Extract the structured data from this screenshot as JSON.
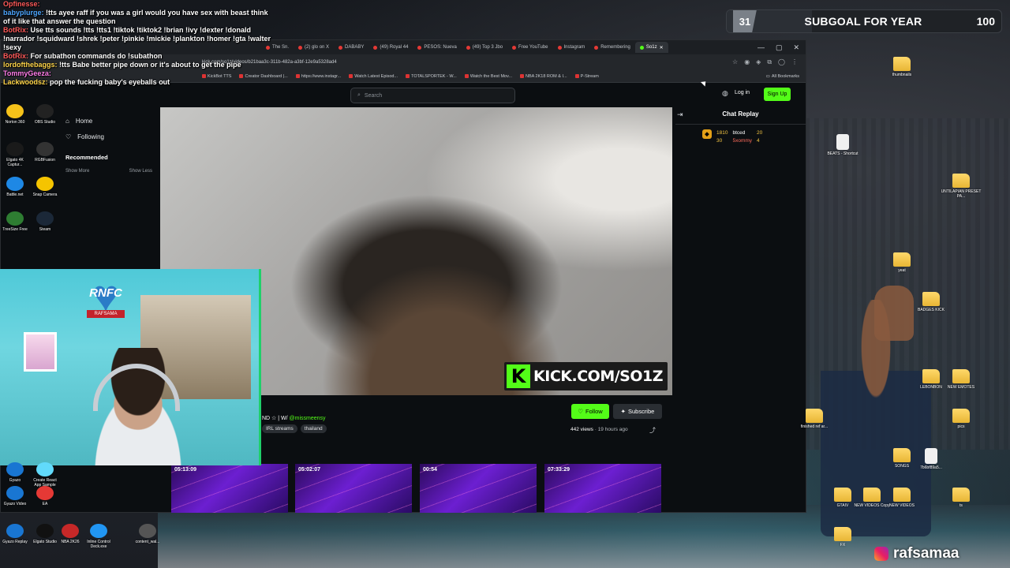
{
  "overlay_chat": [
    {
      "name": "Opfinesse:",
      "text": "",
      "color": "#ff5a5a"
    },
    {
      "name": "babyplurge:",
      "text": " !tts ayee raff if you was a girl would you have sex with beast think of it like that answer the question",
      "color": "#4da6ff"
    },
    {
      "name": "BotRix:",
      "text": " Use tts sounds !tts !tts1 !tiktok !tiktok2 !brian !ivy !dexter !donald !narrador !squidward !shrek !peter !pinkie !mickie !plankton !homer !gta !walter !sexy",
      "color": "#ff5a5a"
    },
    {
      "name": "BotRix:",
      "text": " For subathon commands do !subathon",
      "color": "#ff5a5a"
    },
    {
      "name": "lordofthebaggs:",
      "text": " !tts Babe better pipe down or it's about to get the pipe",
      "color": "#ffd54a"
    },
    {
      "name": "TommyGeeza:",
      "text": "",
      "color": "#ff7de9"
    },
    {
      "name": "Lackwoodsz:",
      "text": " pop the fucking baby's eyeballs out",
      "color": "#ffd54a"
    }
  ],
  "subgoal": {
    "count": "31",
    "title": "SUBGOAL FOR YEAR",
    "target": "100",
    "progress_fraction": 0.31
  },
  "browser": {
    "tabs": [
      "The Sn.",
      "(2) glo on X",
      "DABABY",
      "(49) Royal 44",
      "PESOS: Nueva",
      "(49) Top 3 Jbo",
      "Free YouTube",
      "Instagram",
      "Remembering",
      "So1z"
    ],
    "url": "kick.com/so1z/videos/b21baa3c-311b-482a-a3bf-12e9a5328ad4",
    "bookmarks": [
      "KickBot TTS",
      "Creator Dashboard |...",
      "https://www.instagr...",
      "Watch Latest Episod...",
      "TOTALSPORTEK - W...",
      "Watch the Best Mov...",
      "NBA 2K18 ROM & I...",
      "P-Stream"
    ],
    "all_bookmarks": "All Bookmarks",
    "win_controls": [
      "—",
      "▢",
      "✕"
    ]
  },
  "kick": {
    "search_placeholder": "Search",
    "login": "Log in",
    "signup": "Sign Up",
    "sidebar": {
      "home": "Home",
      "following": "Following",
      "recommended": "Recommended",
      "show_more": "Show More",
      "show_less": "Show Less"
    },
    "watermark": "KICK.COM/SO1Z",
    "chat_title": "Chat Replay",
    "chat_stats": {
      "a": "1810",
      "b": "30",
      "c": "btced",
      "d": "5xommy",
      "e": "20",
      "f": "4"
    },
    "stream_title_prefix": "ND ☆ | W/ ",
    "stream_title_mention": "@missmeensy",
    "tags": [
      "IRL streams",
      "thailand"
    ],
    "follow": "Follow",
    "subscribe": "Subscribe",
    "views": "442 views",
    "ago": "19 hours ago",
    "vods": [
      "05:13:09",
      "05:02:07",
      "00:54",
      "07:33:29"
    ]
  },
  "webcam": {
    "heart_text": "RNFC",
    "badge": "RAFSAMA"
  },
  "desktop_icons": [
    {
      "label": "thumbnails",
      "type": "folder"
    },
    {
      "label": "BEATS - Shortcut",
      "type": "file"
    },
    {
      "label": "UNTILAPIAN PRESET PA...",
      "type": "folder"
    },
    {
      "label": "yeat",
      "type": "folder"
    },
    {
      "label": "BADGES KICK",
      "type": "folder"
    },
    {
      "label": "LEBONBON",
      "type": "folder"
    },
    {
      "label": "NEW EMOTES",
      "type": "folder"
    },
    {
      "label": "finished ref ar...",
      "type": "folder"
    },
    {
      "label": "pics",
      "type": "folder"
    },
    {
      "label": "SONGS",
      "type": "folder"
    },
    {
      "label": "7b6bf89a5...",
      "type": "file"
    },
    {
      "label": "GTAIV",
      "type": "folder"
    },
    {
      "label": "NEW VIDEOS Copy",
      "type": "folder"
    },
    {
      "label": "NEW VIDEOS",
      "type": "folder"
    },
    {
      "label": "ts",
      "type": "folder"
    },
    {
      "label": "FX",
      "type": "folder"
    }
  ],
  "left_icons": [
    "Norton 360",
    "OBS Studio",
    "Elgato 4K Captur...",
    "RGBFusion",
    "Battle.net",
    "Snap Camera",
    "TreeSize Free",
    "Steam",
    "Gyazo",
    "Create React App Sample",
    "Gyazo Video",
    "EA",
    "Gyazo Replay",
    "Elgato Studio",
    "NBA 2K26",
    "Inline Control Deck.exe",
    "content_wal..."
  ],
  "handle": "rafsamaa",
  "colors": {
    "kick_green": "#53fc18",
    "bg": "#0b0e11"
  }
}
